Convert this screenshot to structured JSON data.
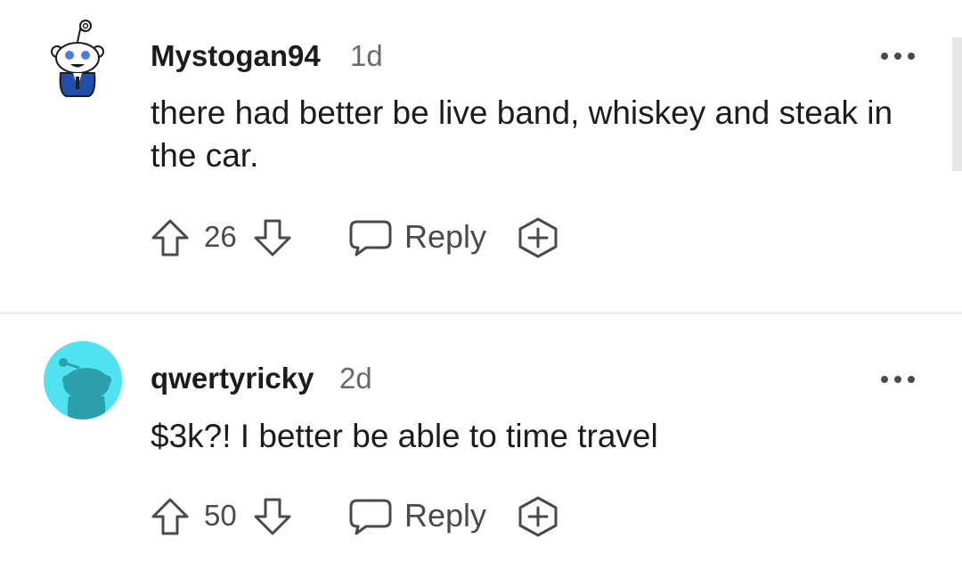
{
  "comments": [
    {
      "username": "Mystogan94",
      "age": "1d",
      "body": "there had better be live band, whiskey and steak in the car.",
      "score": "26",
      "reply_label": "Reply",
      "avatar_icon": "snoo-avatar-icon"
    },
    {
      "username": "qwertyricky",
      "age": "2d",
      "body": "$3k?! I better be able to time travel",
      "score": "50",
      "reply_label": "Reply",
      "avatar_icon": "default-snoo-avatar-icon"
    }
  ],
  "colors": {
    "text": "#1c1c1c",
    "muted": "#6a6a6a",
    "icon": "#4a4a4a",
    "divider": "#ececec",
    "default_avatar_bg": "#4fe3f1",
    "default_avatar_fg": "#2c9fae",
    "snoo_suit": "#1f4fa8"
  },
  "icons": {
    "more": "more-options-icon",
    "upvote": "upvote-arrow-icon",
    "downvote": "downvote-arrow-icon",
    "reply": "reply-bubble-icon",
    "award": "award-plus-icon"
  }
}
